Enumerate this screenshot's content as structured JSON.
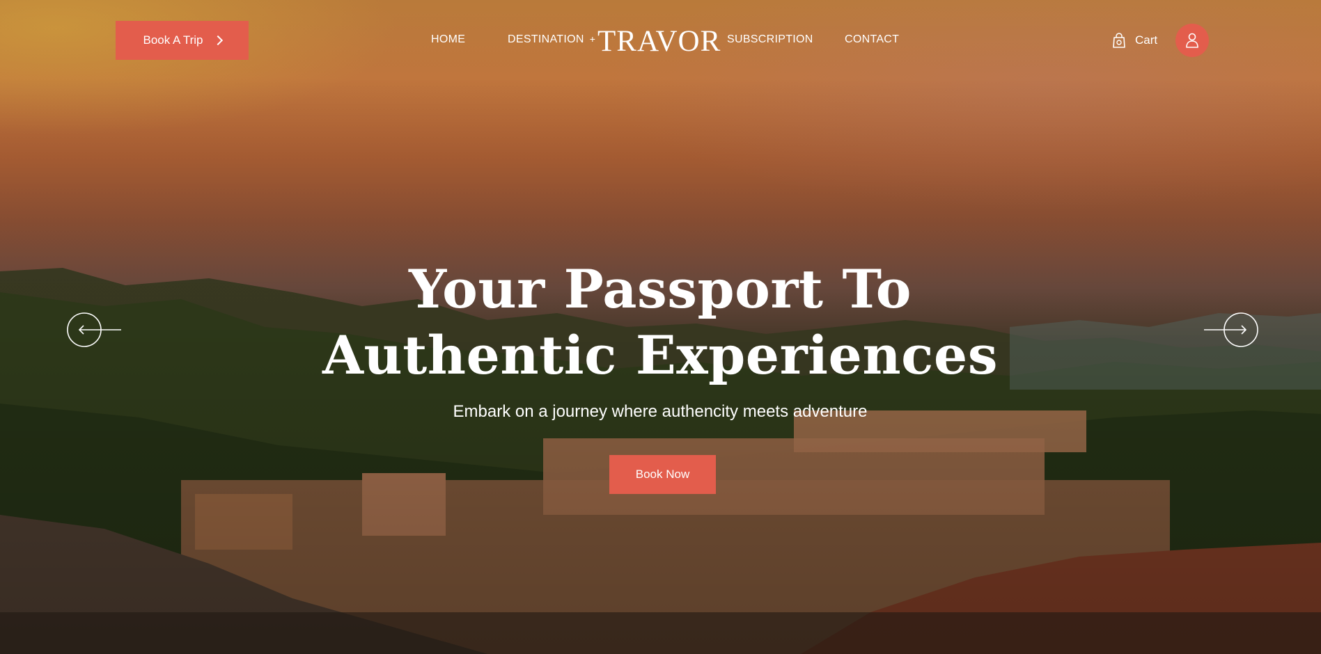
{
  "header": {
    "book_trip_label": "Book A Trip",
    "logo": "TRAVOR",
    "nav": {
      "home": "HOME",
      "destination": "DESTINATION",
      "destination_plus": "+",
      "subscription": "SUBSCRIPTION",
      "contact": "CONTACT"
    },
    "cart_label": "Cart"
  },
  "hero": {
    "headline_line1": "Your Passport To",
    "headline_line2": "Authentic Experiences",
    "subline": "Embark on a journey where authencity meets adventure",
    "cta_label": "Book Now"
  },
  "icons": {
    "book_trip": "chevron-right-icon",
    "cart": "shopping-bag-icon",
    "user": "user-icon",
    "prev": "arrow-left-icon",
    "next": "arrow-right-icon"
  },
  "colors": {
    "accent": "#e35d4c",
    "text": "#ffffff"
  }
}
